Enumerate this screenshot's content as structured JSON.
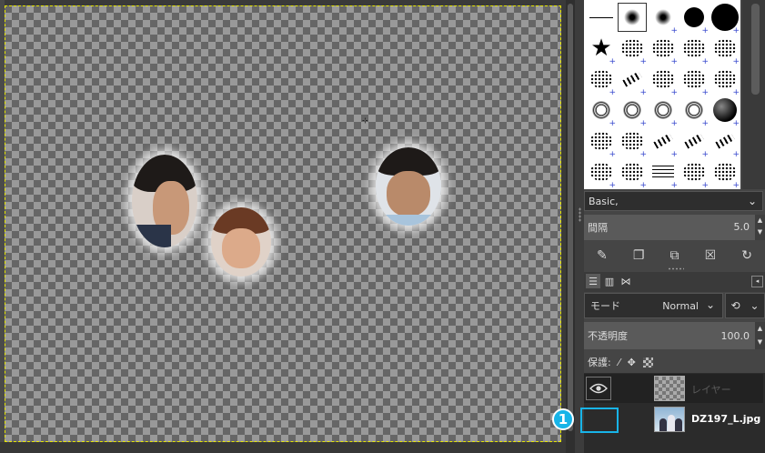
{
  "brushes": {
    "preset_label": "Basic,",
    "spacing_label": "間隔",
    "spacing_value": "5.0"
  },
  "brush_tools": {
    "icons": [
      "edit-brush-icon",
      "new-brush-icon",
      "duplicate-brush-icon",
      "delete-brush-icon",
      "refresh-brushes-icon"
    ]
  },
  "layers": {
    "mode_label": "モード",
    "mode_value": "Normal",
    "opacity_label": "不透明度",
    "opacity_value": "100.0",
    "lock_label": "保護:",
    "items": [
      {
        "name": "レイヤー",
        "visible": true
      },
      {
        "name": "DZ197_L.jpg",
        "visible": false
      }
    ]
  },
  "annotation": {
    "callout_number": "1",
    "callout_color": "#18b4e8"
  },
  "colors": {
    "panel_bg": "#454545",
    "selection_dash": "#e8e800"
  }
}
